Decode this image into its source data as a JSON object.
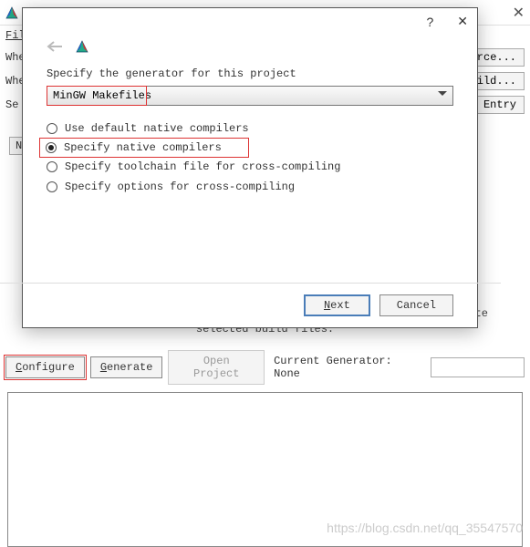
{
  "main": {
    "menu": {
      "file": "File"
    },
    "rows": {
      "where_src": "Whe",
      "where_build": "Whe",
      "search": "Se",
      "browse_source": "ource...",
      "browse_build": "uild...",
      "add_entry": "Entry"
    },
    "name_col": "N",
    "center_line2": "selected build files.",
    "actions": {
      "configure": "Configure",
      "generate": "Generate",
      "open_project": "Open Project",
      "erate": "erate"
    },
    "current_generator": "Current Generator: None"
  },
  "dialog": {
    "help": "?",
    "close": "✕",
    "prompt": "Specify the generator for this project",
    "dropdown_value": "MinGW Makefiles",
    "options": {
      "default": "Use default native compilers",
      "native": "Specify native compilers",
      "toolchain": "Specify toolchain file for cross-compiling",
      "cross": "Specify options for cross-compiling"
    },
    "buttons": {
      "next": "Next",
      "cancel": "Cancel"
    }
  },
  "watermark": "https://blog.csdn.net/qq_35547570"
}
